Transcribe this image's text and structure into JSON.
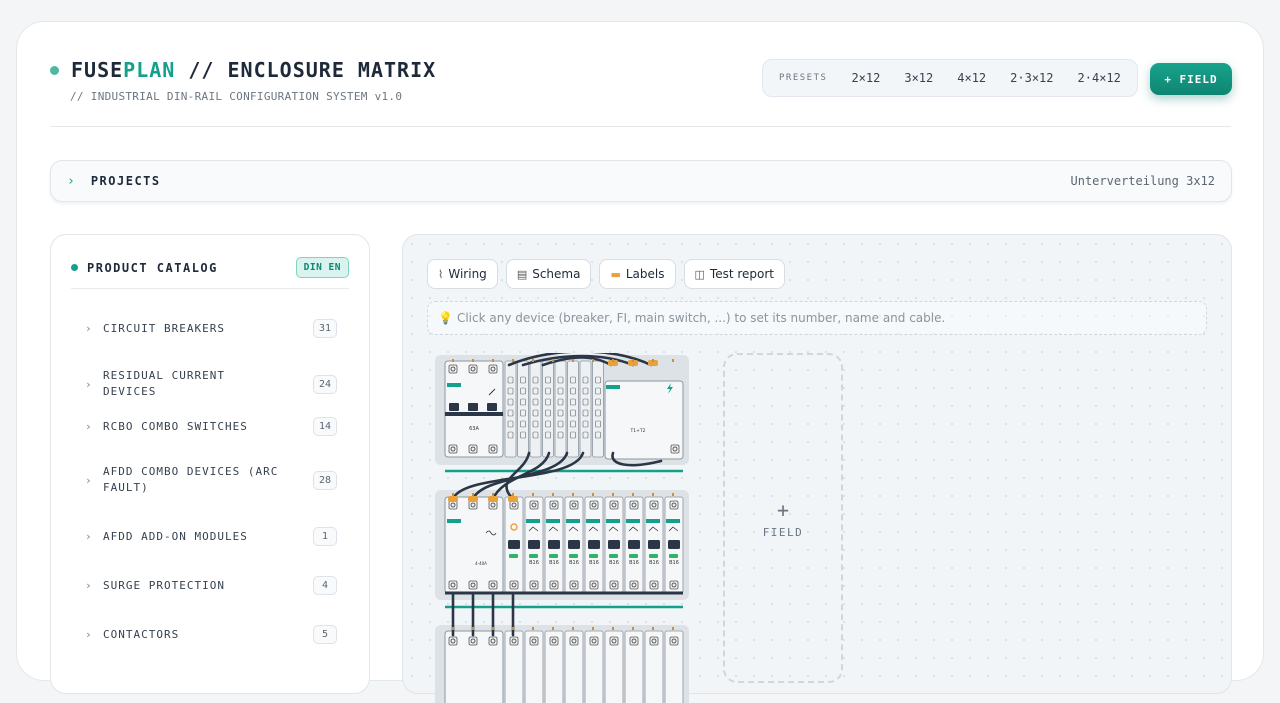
{
  "app": {
    "title_a": "FUSE",
    "title_b": "PLAN",
    "title_c": " // ENCLOSURE MATRIX",
    "subtitle": "// INDUSTRIAL DIN-RAIL CONFIGURATION SYSTEM v1.0"
  },
  "presets": {
    "label": "PRESETS",
    "items": [
      "2×12",
      "3×12",
      "4×12",
      "2·3×12",
      "2·4×12"
    ]
  },
  "add_field_label": "+ FIELD",
  "projects": {
    "chevron": "›",
    "label": "PROJECTS",
    "current": "Unterverteilung 3x12"
  },
  "catalog": {
    "title": "PRODUCT CATALOG",
    "badge": "DIN EN",
    "items": [
      {
        "name": "CIRCUIT BREAKERS",
        "count": "31"
      },
      {
        "name": "RESIDUAL CURRENT DEVICES",
        "count": "24"
      },
      {
        "name": "RCBO COMBO SWITCHES",
        "count": "14"
      },
      {
        "name": "AFDD COMBO DEVICES (ARC FAULT)",
        "count": "28"
      },
      {
        "name": "AFDD ADD-ON MODULES",
        "count": "1"
      },
      {
        "name": "SURGE PROTECTION",
        "count": "4"
      },
      {
        "name": "CONTACTORS",
        "count": "5"
      }
    ]
  },
  "toolbar": {
    "wiring": "Wiring",
    "schema": "Schema",
    "labels": "Labels",
    "test_report": "Test report"
  },
  "hint": "Click any device (breaker, FI, main switch, ...) to set its number, name and cable.",
  "new_field_label": "FIELD",
  "devices": {
    "main_switch_rating": "63A",
    "spd_label": "T1+T2",
    "rcd_rating": "4-40A",
    "breaker_rating": "B16"
  },
  "colors": {
    "accent": "#14a08a",
    "cable": "#2b3646",
    "terminal": "#e9a23b"
  },
  "icons": {
    "wiring": "wiring-icon",
    "schema": "schema-icon",
    "labels": "label-icon",
    "test_report": "report-icon",
    "hint": "lightbulb-icon",
    "add": "plus-icon"
  }
}
